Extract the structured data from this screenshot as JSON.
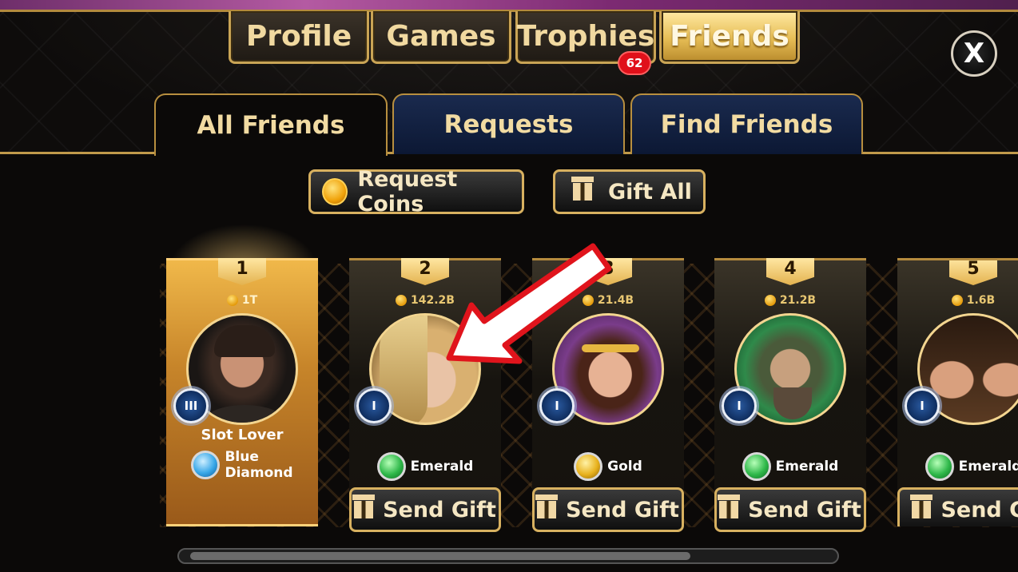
{
  "top_tabs": [
    {
      "label": "Profile",
      "active": false
    },
    {
      "label": "Games",
      "active": false
    },
    {
      "label": "Trophies",
      "active": false,
      "badge": "62"
    },
    {
      "label": "Friends",
      "active": true
    }
  ],
  "close_label": "X",
  "sub_tabs": [
    {
      "label": "All Friends",
      "active": true
    },
    {
      "label": "Requests",
      "active": false
    },
    {
      "label": "Find Friends",
      "active": false
    }
  ],
  "actions": {
    "request_coins": "Request Coins",
    "gift_all": "Gift All"
  },
  "friends": [
    {
      "rank": "1",
      "coins": "1T",
      "name": "Slot Lover",
      "vip": "III",
      "tier": "Blue\nDiamond",
      "tier_color": "#39a8e8",
      "highlight": true
    },
    {
      "rank": "2",
      "coins": "142.2B",
      "vip": "I",
      "tier": "Emerald",
      "tier_color": "#2fb84a",
      "send_label": "Send Gift"
    },
    {
      "rank": "3",
      "coins": "21.4B",
      "vip": "I",
      "tier": "Gold",
      "tier_color": "#e8b21e",
      "send_label": "Send Gift"
    },
    {
      "rank": "4",
      "coins": "21.2B",
      "vip": "I",
      "tier": "Emerald",
      "tier_color": "#2fb84a",
      "send_label": "Send Gift"
    },
    {
      "rank": "5",
      "coins": "1.6B",
      "vip": "I",
      "tier": "Emerald",
      "tier_color": "#2fb84a",
      "send_label": "Send Gi"
    }
  ],
  "colors": {
    "gold_border": "#c9a455",
    "annotation_arrow": "#e0141c"
  }
}
